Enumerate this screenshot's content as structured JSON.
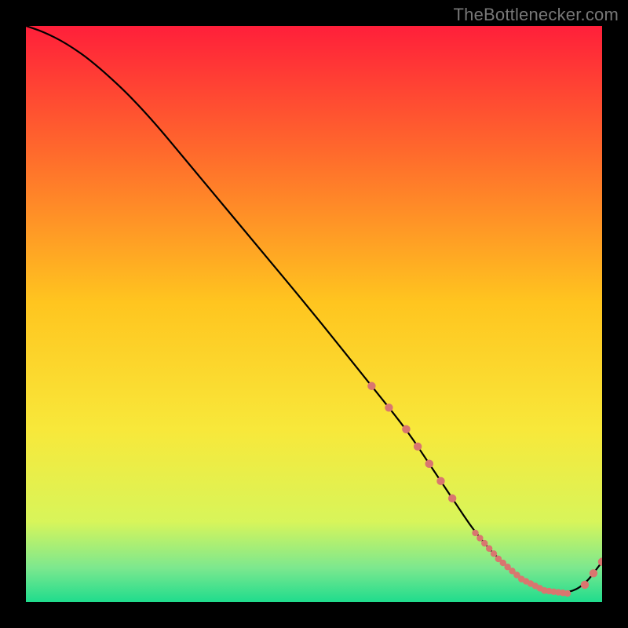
{
  "attribution": "TheBottlenecker.com",
  "colors": {
    "bg": "#000000",
    "grad_top": "#ff1f3a",
    "grad_mid_upper": "#ff6a2c",
    "grad_mid": "#ffc51f",
    "grad_mid_lower": "#f8e83a",
    "grad_low1": "#d8f55a",
    "grad_low2": "#7de88e",
    "grad_bottom": "#1fdc8d",
    "curve": "#000000",
    "marker_fill": "#d9766f",
    "marker_stroke": "#d9766f",
    "attribution": "#777777"
  },
  "chart_data": {
    "type": "line",
    "title": "",
    "xlabel": "",
    "ylabel": "",
    "xlim": [
      0,
      100
    ],
    "ylim": [
      0,
      100
    ],
    "x": [
      0,
      3,
      7,
      12,
      20,
      30,
      40,
      50,
      60,
      66,
      70,
      74,
      78,
      82,
      86,
      90,
      94,
      97,
      100
    ],
    "values": [
      100,
      99,
      97,
      93.5,
      86,
      74,
      62,
      50,
      37.5,
      30,
      24,
      18,
      12,
      7.5,
      4,
      2,
      1.5,
      3,
      7
    ],
    "marker_segments": [
      {
        "start_idx": 8,
        "end_idx": 11,
        "dense": false
      },
      {
        "start_idx": 12,
        "end_idx": 16,
        "dense": true
      },
      {
        "start_idx": 17,
        "end_idx": 18,
        "dense": false
      }
    ]
  }
}
